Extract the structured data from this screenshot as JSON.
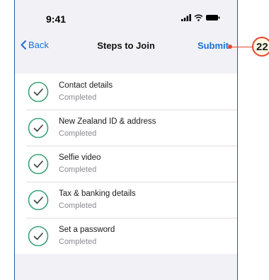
{
  "status_bar": {
    "time": "9:41",
    "icons": [
      "signal-icon",
      "wifi-icon",
      "battery-icon"
    ]
  },
  "nav": {
    "back_label": "Back",
    "title": "Steps to Join",
    "submit_label": "Submit"
  },
  "steps": [
    {
      "title": "Contact details",
      "status": "Completed"
    },
    {
      "title": "New Zealand ID & address",
      "status": "Completed"
    },
    {
      "title": "Selfie video",
      "status": "Completed"
    },
    {
      "title": "Tax & banking details",
      "status": "Completed"
    },
    {
      "title": "Set a password",
      "status": "Completed"
    }
  ],
  "annotation": {
    "number": "22"
  },
  "colors": {
    "accent": "#1a6fd6",
    "check_green": "#3aa37a",
    "callout": "#e4472e"
  }
}
